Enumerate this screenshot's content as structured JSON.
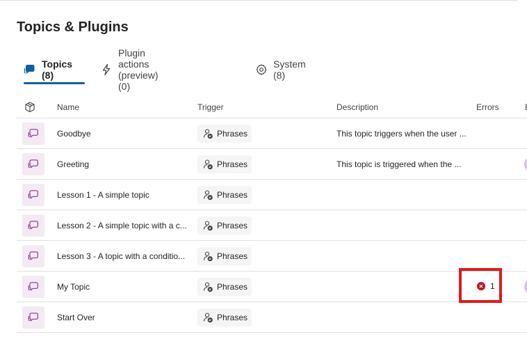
{
  "page": {
    "title": "Topics & Plugins"
  },
  "tabs": [
    {
      "label": "Topics (8)",
      "icon": "chat-bubble-icon",
      "active": true
    },
    {
      "label": "Plugin actions (preview) (0)",
      "icon": "lightning-icon",
      "active": false
    },
    {
      "label": "System (8)",
      "icon": "gear-icon",
      "active": false
    }
  ],
  "table": {
    "columns": {
      "icon": "cube-icon",
      "name": "Name",
      "trigger": "Trigger",
      "description": "Description",
      "errors": "Errors",
      "extra": "E"
    },
    "rows": [
      {
        "name": "Goodbye",
        "trigger": "Phrases",
        "description": "This topic triggers when the user ...",
        "errors": "",
        "avatar": false
      },
      {
        "name": "Greeting",
        "trigger": "Phrases",
        "description": "This topic is triggered when the ...",
        "errors": "",
        "avatar": true
      },
      {
        "name": "Lesson 1 - A simple topic",
        "trigger": "Phrases",
        "description": "",
        "errors": "",
        "avatar": false
      },
      {
        "name": "Lesson 2 - A simple topic with a c...",
        "trigger": "Phrases",
        "description": "",
        "errors": "",
        "avatar": false
      },
      {
        "name": "Lesson 3 - A topic with a conditio...",
        "trigger": "Phrases",
        "description": "",
        "errors": "",
        "avatar": false
      },
      {
        "name": "My Topic",
        "trigger": "Phrases",
        "description": "",
        "errors": "1",
        "avatar": true
      },
      {
        "name": "Start Over",
        "trigger": "Phrases",
        "description": "",
        "errors": "",
        "avatar": false
      }
    ]
  },
  "colors": {
    "accent": "#115ea3",
    "topic_tile": "#f3eaf3",
    "topic_icon": "#8a3a8e",
    "error": "#c50f1f",
    "highlight": "#e01919"
  }
}
